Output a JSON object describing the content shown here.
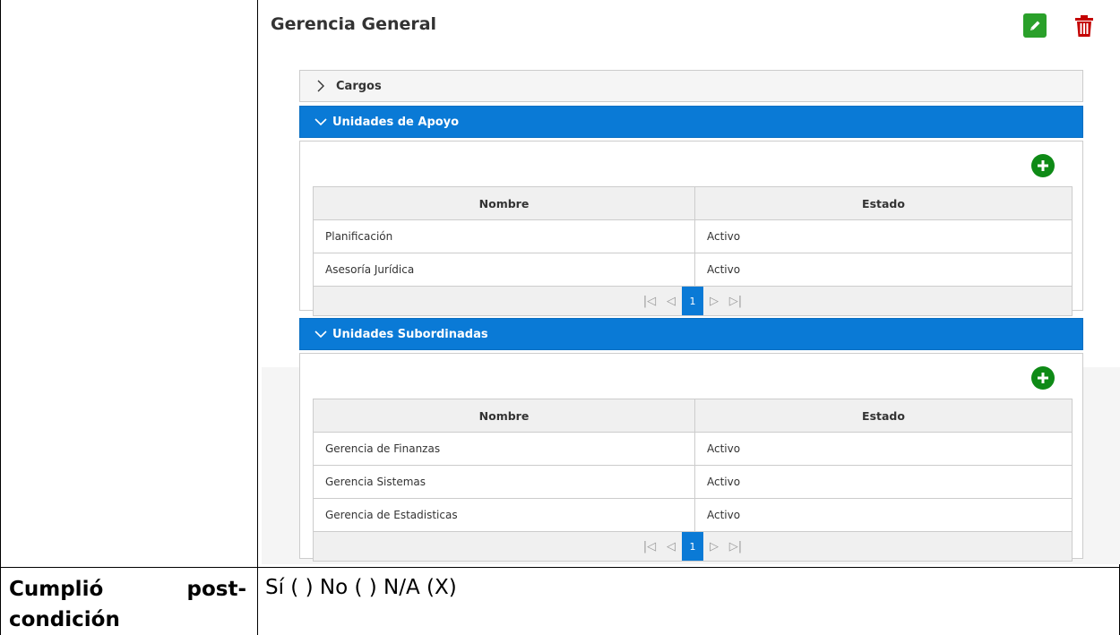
{
  "unit": {
    "title": "Gerencia General"
  },
  "sections": {
    "cargos": {
      "label": "Cargos"
    },
    "apoyo": {
      "label": "Unidades de Apoyo",
      "columns": [
        "Nombre",
        "Estado"
      ],
      "rows": [
        {
          "nombre": "Planificación",
          "estado": "Activo"
        },
        {
          "nombre": "Asesoría Jurídica",
          "estado": "Activo"
        }
      ],
      "page": "1"
    },
    "subordinadas": {
      "label": "Unidades Subordinadas",
      "columns": [
        "Nombre",
        "Estado"
      ],
      "rows": [
        {
          "nombre": "Gerencia de Finanzas",
          "estado": "Activo"
        },
        {
          "nombre": "Gerencia Sistemas",
          "estado": "Activo"
        },
        {
          "nombre": "Gerencia de Estadisticas",
          "estado": "Activo"
        }
      ],
      "page": "1"
    }
  },
  "footer": {
    "label_word1": "Cumplió",
    "label_word2": "post-",
    "label_line2": "condición",
    "value": "Sí ( )  No ( )  N/A (X)"
  },
  "colors": {
    "accent": "#0a7ad6",
    "add": "#0e8a16",
    "edit": "#2aa02a",
    "delete": "#c40000"
  }
}
